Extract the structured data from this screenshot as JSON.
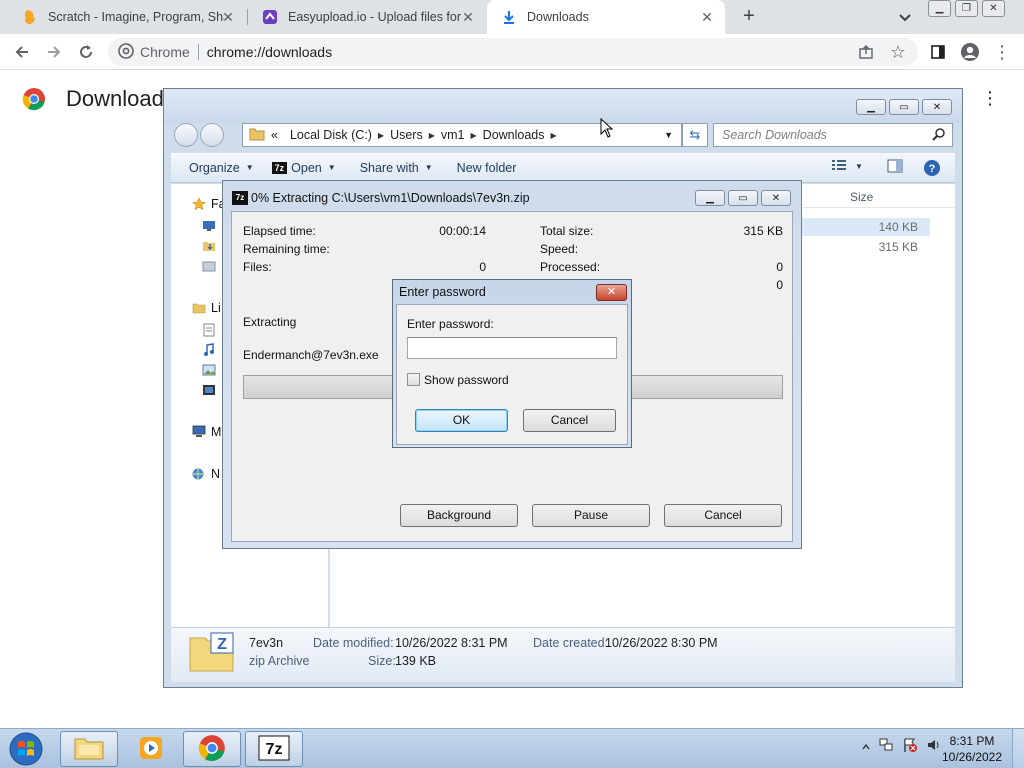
{
  "browser": {
    "tabs": [
      {
        "title": "Scratch - Imagine, Program, Shar",
        "active": false
      },
      {
        "title": "Easyupload.io - Upload files for f",
        "active": false
      },
      {
        "title": "Downloads",
        "active": true
      }
    ],
    "omnibox": {
      "chip": "Chrome",
      "url": "chrome://downloads"
    },
    "page_title": "Download"
  },
  "explorer": {
    "breadcrumb": {
      "prefix": "«",
      "items": [
        "Local Disk (C:)",
        "Users",
        "vm1",
        "Downloads"
      ]
    },
    "search_placeholder": "Search Downloads",
    "commands": {
      "organize": "Organize",
      "open": "Open",
      "share": "Share with",
      "new_folder": "New folder"
    },
    "nav_items": [
      {
        "label": "Fa",
        "icon": "star-icon"
      },
      {
        "label": "Li",
        "icon": "library-icon"
      },
      {
        "label": "M",
        "icon": "computer-icon"
      },
      {
        "label": "N",
        "icon": "network-icon"
      }
    ],
    "column_size": "Size",
    "file_sizes": [
      "140 KB",
      "315 KB"
    ],
    "details": {
      "name": "7ev3n",
      "type": "zip Archive",
      "modified_label": "Date modified:",
      "modified_value": "10/26/2022 8:31 PM",
      "created_label": "Date created:",
      "created_value": "10/26/2022 8:30 PM",
      "size_label": "Size:",
      "size_value": "139 KB"
    }
  },
  "sevenzip": {
    "title": "0% Extracting C:\\Users\\vm1\\Downloads\\7ev3n.zip",
    "elapsed_label": "Elapsed time:",
    "elapsed_value": "00:00:14",
    "remaining_label": "Remaining time:",
    "files_label": "Files:",
    "files_value": "0",
    "total_label": "Total size:",
    "total_value": "315 KB",
    "speed_label": "Speed:",
    "processed_label": "Processed:",
    "processed_value": "0",
    "extra_value": "0",
    "status": "Extracting",
    "current_file": "Endermanch@7ev3n.exe",
    "progress": 0,
    "buttons": {
      "background": "Background",
      "pause": "Pause",
      "cancel": "Cancel"
    }
  },
  "password_dialog": {
    "title": "Enter password",
    "prompt": "Enter password:",
    "value": "",
    "show_password_label": "Show password",
    "show_password_checked": false,
    "ok": "OK",
    "cancel": "Cancel"
  },
  "taskbar": {
    "time": "8:31 PM",
    "date": "10/26/2022"
  }
}
